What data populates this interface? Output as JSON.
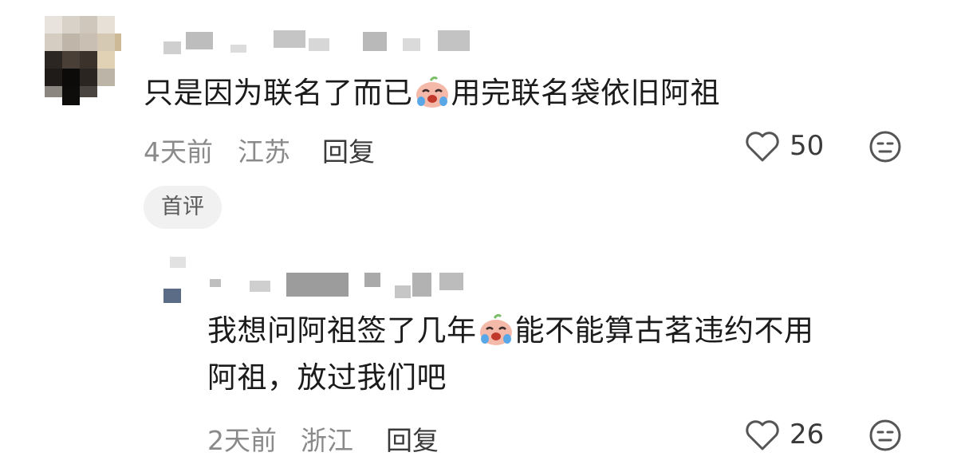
{
  "comments": [
    {
      "text_before_emoji": "只是因为联名了而已",
      "emoji": "crying-face-emoji",
      "text_after_emoji": "用完联名袋依旧阿祖",
      "time": "4天前",
      "location": "江苏",
      "reply_label": "回复",
      "likes": "50",
      "tag": "首评"
    },
    {
      "text_line1_before_emoji": "我想问阿祖签了几年",
      "emoji": "crying-face-emoji",
      "text_line1_after_emoji": "能不能算古茗违约不用",
      "text_line2": "阿祖，放过我们吧",
      "time": "2天前",
      "location": "浙江",
      "reply_label": "回复",
      "likes": "26"
    }
  ],
  "colors": {
    "meta_gray": "#8a8a8a",
    "tag_bg": "#f1f1f1",
    "text_dark": "#1b1b1b"
  }
}
